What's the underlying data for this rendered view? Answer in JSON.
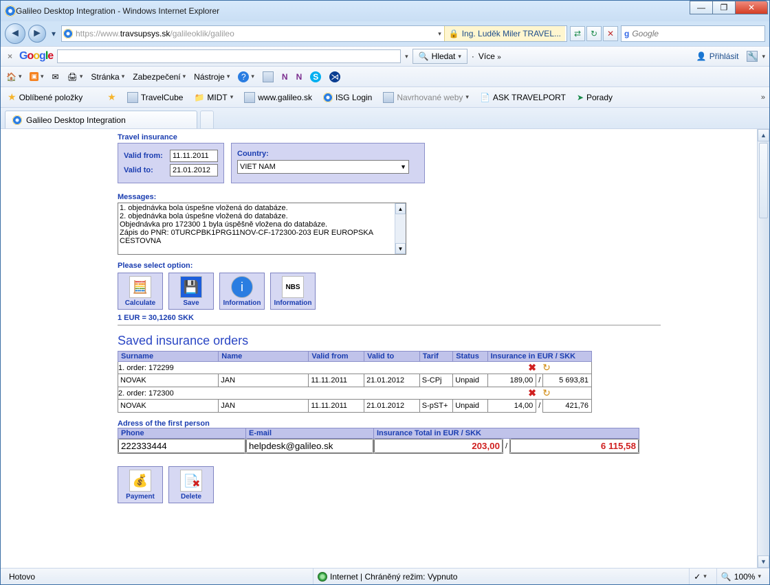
{
  "window": {
    "title": "Galileo Desktop Integration - Windows Internet Explorer"
  },
  "address": {
    "url_gray_prefix": "https://www.",
    "url_dark": "travsupsys.sk",
    "url_gray_suffix": "/galileoklik/galileo",
    "cert_text": "Ing. Luděk Miler TRAVEL..."
  },
  "search": {
    "placeholder": "Google"
  },
  "gtoolbar": {
    "search_btn": "Hledat",
    "more_btn": "Více",
    "signin": "Přihlásit"
  },
  "cmdbar": {
    "page": "Stránka",
    "safety": "Zabezpečení",
    "tools": "Nástroje"
  },
  "favbar": {
    "favorites": "Oblíbené položky",
    "travelcube": "TravelCube",
    "midt": "MIDT",
    "galileo": "www.galileo.sk",
    "isg": "ISG Login",
    "suggested": "Navrhované weby",
    "ask": "ASK TRAVELPORT",
    "porady": "Porady"
  },
  "tab": {
    "title": "Galileo Desktop Integration"
  },
  "page": {
    "travel_insurance_title": "Travel insurance",
    "valid_from_lbl": "Valid from:",
    "valid_from": "11.11.2011",
    "valid_to_lbl": "Valid to:",
    "valid_to": "21.01.2012",
    "country_lbl": "Country:",
    "country": "VIET NAM",
    "messages_lbl": "Messages:",
    "messages": "1. objednávka bola úspešne vložená do databáze.\n2. objednávka bola úspešne vložená do databáze.\nObjednávka pro 172300 1 byla úspěšně vložena do databáze.\nZápis do PNR: 0TURCPBK1PRG11NOV-CF-172300-203 EUR EUROPSKA CESTOVNA",
    "select_option_lbl": "Please select option:",
    "btn_calculate": "Calculate",
    "btn_save": "Save",
    "btn_info1": "Information",
    "btn_info2": "Information",
    "rate": "1 EUR = 30,1260 SKK",
    "saved_title": "Saved insurance orders",
    "cols": {
      "surname": "Surname",
      "name": "Name",
      "valid_from": "Valid from",
      "valid_to": "Valid to",
      "tarif": "Tarif",
      "status": "Status",
      "ins": "Insurance in EUR / SKK"
    },
    "orders": [
      {
        "header": "1. order: 172299",
        "surname": "NOVAK",
        "name": "JAN",
        "vf": "11.11.2011",
        "vt": "21.01.2012",
        "tarif": "S-CPj",
        "status": "Unpaid",
        "eur": "189,00",
        "skk": "5 693,81"
      },
      {
        "header": "2. order: 172300",
        "surname": "NOVAK",
        "name": "JAN",
        "vf": "11.11.2011",
        "vt": "21.01.2012",
        "tarif": "S-pST+",
        "status": "Unpaid",
        "eur": "14,00",
        "skk": "421,76"
      }
    ],
    "addr_title": "Adress of the first person",
    "addr_cols": {
      "phone": "Phone",
      "email": "E-mail",
      "total": "Insurance Total in EUR / SKK"
    },
    "phone": "222333444",
    "email": "helpdesk@galileo.sk",
    "total_eur": "203,00",
    "total_skk": "6 115,58",
    "btn_payment": "Payment",
    "btn_delete": "Delete"
  },
  "status": {
    "left": "Hotovo",
    "zone": "Internet | Chráněný režim: Vypnuto",
    "zoom": "100%"
  }
}
